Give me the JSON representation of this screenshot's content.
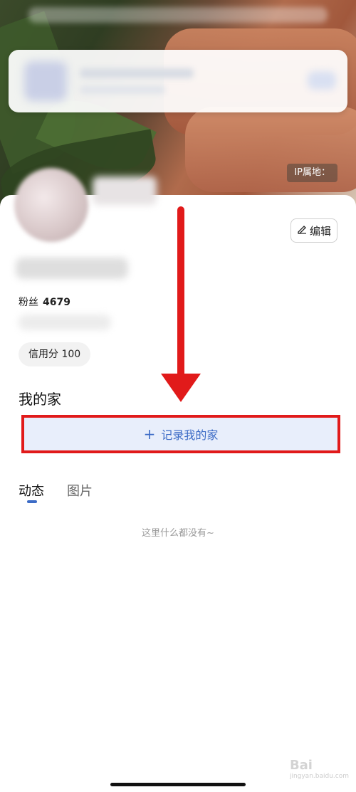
{
  "cover": {
    "ip_label": "IP属地："
  },
  "profile": {
    "edit_label": "编辑",
    "fans_label": "粉丝",
    "fans_count": "4679",
    "credit_label": "信用分 100"
  },
  "home": {
    "title": "我的家",
    "record_label": "记录我的家",
    "record_plus": "+"
  },
  "tabs": [
    {
      "label": "动态",
      "active": true
    },
    {
      "label": "图片",
      "active": false
    }
  ],
  "feed": {
    "empty_text": "这里什么都没有~"
  },
  "watermark": {
    "brand": "Bai",
    "site": "jingyan.baidu.com"
  },
  "colors": {
    "accent": "#3c6bc6",
    "annotation_red": "#e11a1a",
    "record_bg": "#e8eefb"
  },
  "icons": {
    "edit": "pencil-icon"
  }
}
